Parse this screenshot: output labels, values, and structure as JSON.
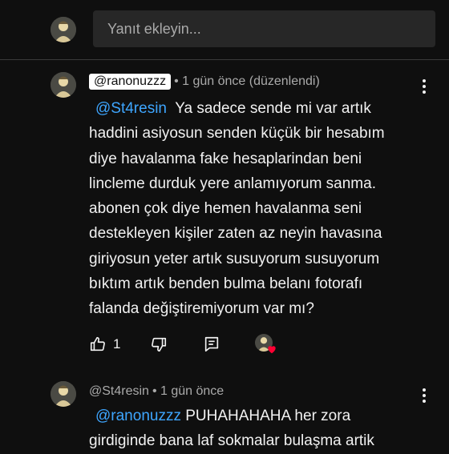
{
  "reply": {
    "placeholder": "Yanıt ekleyin..."
  },
  "comments": [
    {
      "handle": "@ranonuzzz",
      "meta": "• 1 gün önce (düzenlendi)",
      "mention": "@St4resin",
      "lines": [
        "Ya sadece sende mi var artık",
        "haddini asiyosun senden küçük bir hesabım",
        "diye havalanma fake hesaplarindan beni",
        "lincleme durduk yere anlamıyorum sanma.",
        "abonen çok diye hemen havalanma seni",
        "destekleyen kişiler zaten az neyin havasına",
        "giriyosun yeter artık susuyorum susuyorum",
        "bıktım artık benden bulma belanı fotorafı",
        "falanda değiştiremiyorum var mı?"
      ],
      "like_count": "1"
    },
    {
      "handle": "@St4resin",
      "meta": "• 1 gün önce",
      "mention": "@ranonuzzz",
      "lines": [
        "PUHAHAHAHA her zora",
        "girdiginde bana laf sokmalar bulaşma artik"
      ]
    }
  ],
  "icons": {
    "like": "thumb-up-icon",
    "dislike": "thumb-down-icon",
    "reply": "reply-comment-icon",
    "more": "more-vert-icon",
    "heart": "creator-heart-icon"
  },
  "colors": {
    "background": "#0f0f0f",
    "mention": "#3ea6ff",
    "heart": "#ff0033",
    "muted_text": "#aaaaaa"
  }
}
